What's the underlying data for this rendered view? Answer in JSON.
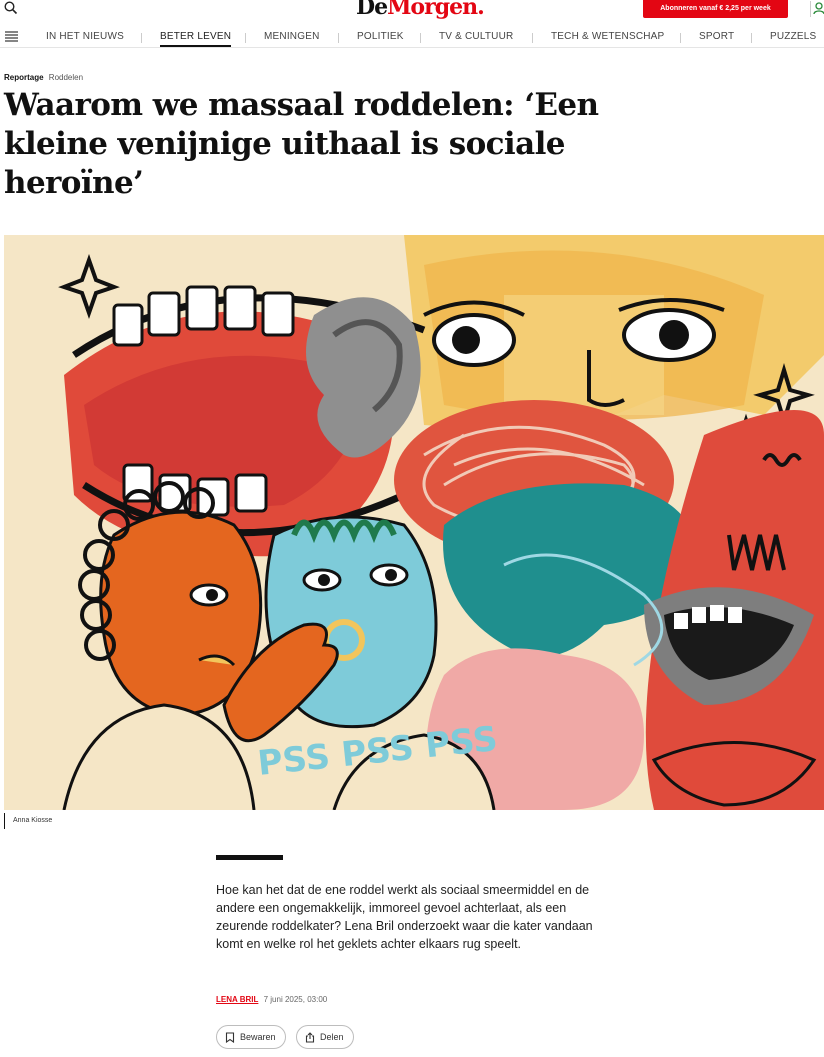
{
  "header": {
    "logo_part1": "De",
    "logo_part2": "Morgen",
    "logo_dot": ".",
    "subscribe_label": "Abonneren vanaf € 2,25 per week",
    "icons": [
      "search-icon",
      "user-icon",
      "menu-icon"
    ]
  },
  "nav": {
    "items": [
      {
        "label": "IN HET NIEUWS"
      },
      {
        "label": "BETER LEVEN"
      },
      {
        "label": "MENINGEN"
      },
      {
        "label": "POLITIEK"
      },
      {
        "label": "TV & CULTUUR"
      },
      {
        "label": "TECH & WETENSCHAP"
      },
      {
        "label": "SPORT"
      },
      {
        "label": "PUZZELS"
      }
    ],
    "active": "BETER LEVEN"
  },
  "article": {
    "kicker_type": "Reportage",
    "kicker_tag": "Roddelen",
    "headline": "Waarom we massaal roddelen: ‘Een kleine venijnige uithaal is sociale heroïne’",
    "image_caption": "Anna Kiosse",
    "image_text": "PSS PSS PSS",
    "lead": "Hoe kan het dat de ene roddel werkt als sociaal smeermiddel en de andere een ongemakkelijk, immoreel gevoel achterlaat, als een zeurende roddelkater? Lena Bril onderzoekt waar die kater vandaan komt en welke rol het geklets achter elkaars rug speelt.",
    "author": "LENA BRIL",
    "date": "7 juni 2025, 03:00"
  },
  "actions": {
    "save_label": "Bewaren",
    "share_label": "Delen"
  },
  "colors": {
    "brand_red": "#e30613",
    "illustration_orange": "#e4661f",
    "illustration_teal": "#1f8f8e",
    "illustration_blue": "#7ecbd9",
    "illustration_yellow": "#f2c55c"
  }
}
